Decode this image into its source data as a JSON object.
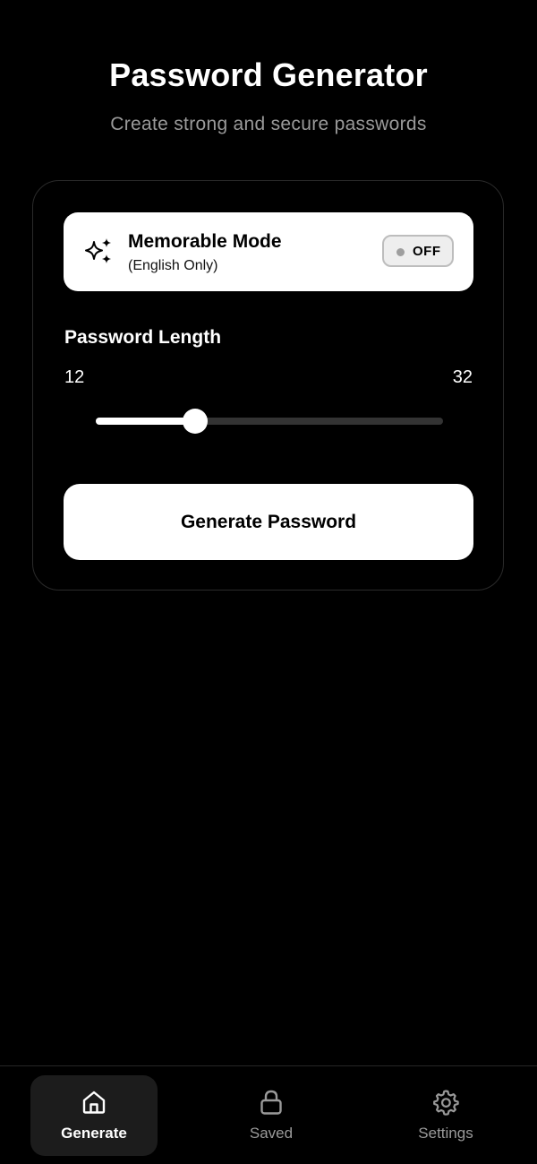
{
  "header": {
    "title": "Password Generator",
    "subtitle": "Create strong and secure passwords"
  },
  "memorable_mode": {
    "title": "Memorable Mode",
    "subtitle": "(English Only)",
    "toggle_label": "OFF",
    "enabled": false,
    "icon": "sparkles-icon"
  },
  "length": {
    "label": "Password Length",
    "value": "12",
    "max_label": "32",
    "slider_fraction": 0.286
  },
  "generate_button": {
    "label": "Generate Password"
  },
  "bottom_nav": {
    "items": [
      {
        "label": "Generate",
        "icon": "home-icon",
        "active": true
      },
      {
        "label": "Saved",
        "icon": "lock-icon",
        "active": false
      },
      {
        "label": "Settings",
        "icon": "gear-icon",
        "active": false
      }
    ]
  },
  "colors": {
    "background": "#000000",
    "card_border": "#2a2a2a",
    "accent": "#ffffff",
    "muted_text": "#9a9a9a",
    "slider_track": "#333333",
    "nav_active_bg": "#1c1c1c"
  }
}
